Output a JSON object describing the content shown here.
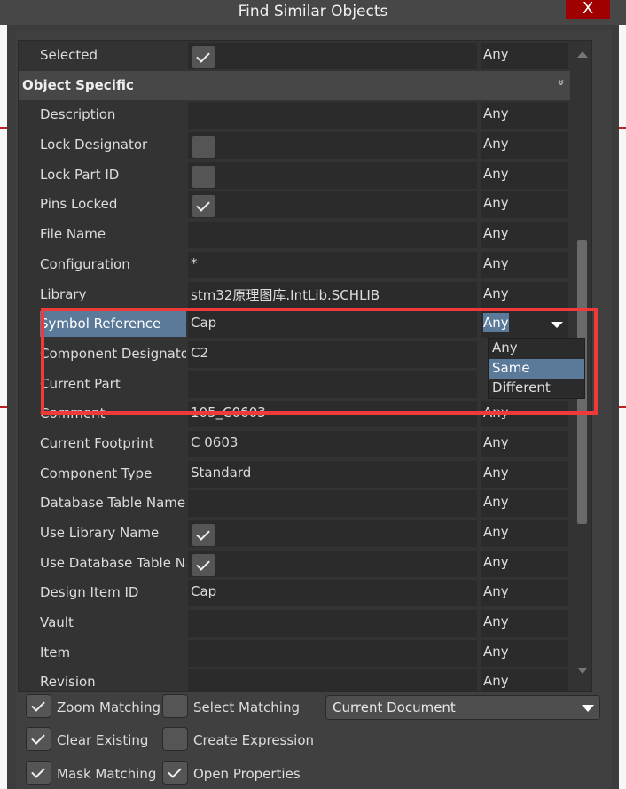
{
  "window": {
    "title": "Find Similar Objects",
    "close_label": "X"
  },
  "grid": {
    "top_rows": [
      {
        "label": "Selected",
        "type": "checkbox",
        "checked": true,
        "match": "Any"
      }
    ],
    "section": {
      "label": "Object Specific",
      "chevron": "»"
    },
    "rows": [
      {
        "label": "Description",
        "value": "",
        "match": "Any"
      },
      {
        "label": "Lock Designator",
        "type": "checkbox",
        "checked": false,
        "match": "Any"
      },
      {
        "label": "Lock Part ID",
        "type": "checkbox",
        "checked": false,
        "match": "Any"
      },
      {
        "label": "Pins Locked",
        "type": "checkbox",
        "checked": true,
        "match": "Any"
      },
      {
        "label": "File Name",
        "value": "",
        "match": "Any"
      },
      {
        "label": "Configuration",
        "value": "*",
        "match": "Any"
      },
      {
        "label": "Library",
        "value": "stm32原理图库.IntLib.SCHLIB",
        "match": "Any"
      },
      {
        "label": "Symbol Reference",
        "value": "Cap",
        "match": "Any",
        "selected": true
      },
      {
        "label": "Component Designator",
        "value": "C2",
        "match": ""
      },
      {
        "label": "Current Part",
        "value": "",
        "match": ""
      },
      {
        "label": "Comment",
        "value": "105_C0603",
        "match": "Any"
      },
      {
        "label": "Current Footprint",
        "value": "C 0603",
        "match": "Any"
      },
      {
        "label": "Component Type",
        "value": "Standard",
        "match": "Any"
      },
      {
        "label": "Database Table Name",
        "value": "",
        "match": "Any"
      },
      {
        "label": "Use Library Name",
        "type": "checkbox",
        "checked": true,
        "match": "Any"
      },
      {
        "label": "Use Database Table Name",
        "type": "checkbox",
        "checked": true,
        "match": "Any"
      },
      {
        "label": "Design Item ID",
        "value": "Cap",
        "match": "Any"
      },
      {
        "label": "Vault",
        "value": "",
        "match": "Any"
      },
      {
        "label": "Item",
        "value": "",
        "match": "Any"
      },
      {
        "label": "Revision",
        "value": "",
        "match": "Any"
      }
    ],
    "dropdown_options": [
      "Any",
      "Same",
      "Different"
    ],
    "dropdown_highlighted": "Same"
  },
  "options": {
    "zoom_matching": {
      "label": "Zoom Matching",
      "checked": true
    },
    "select_matching": {
      "label": "Select Matching",
      "checked": false
    },
    "clear_existing": {
      "label": "Clear Existing",
      "checked": true
    },
    "create_expression": {
      "label": "Create Expression",
      "checked": false
    },
    "mask_matching": {
      "label": "Mask Matching",
      "checked": true
    },
    "open_properties": {
      "label": "Open Properties",
      "checked": true
    },
    "scope": "Current Document"
  },
  "colors": {
    "highlight": "#5b7a99",
    "annotation_box": "#f03a3a",
    "close_button": "#a00000"
  }
}
